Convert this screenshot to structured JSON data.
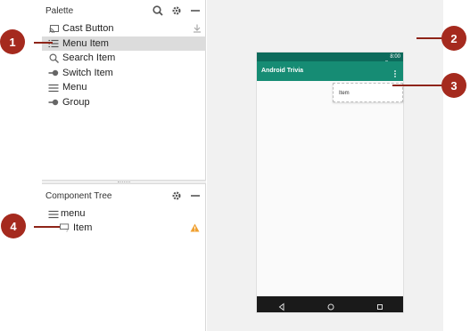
{
  "palette": {
    "title": "Palette",
    "items": [
      {
        "label": "Cast Button",
        "icon": "cast-icon"
      },
      {
        "label": "Menu Item",
        "icon": "menu-item-icon"
      },
      {
        "label": "Search Item",
        "icon": "search-icon"
      },
      {
        "label": "Switch Item",
        "icon": "switch-icon"
      },
      {
        "label": "Menu",
        "icon": "menu-icon"
      },
      {
        "label": "Group",
        "icon": "group-icon"
      }
    ]
  },
  "component_tree": {
    "title": "Component Tree",
    "root": {
      "label": "menu",
      "icon": "menu-icon"
    },
    "child": {
      "label": "Item",
      "icon": "menu-item-icon",
      "status": "warning-icon"
    }
  },
  "phone": {
    "status_time": "8:00",
    "app_title": "Android Trivia",
    "popup_item": "Item"
  },
  "callouts": [
    "1",
    "2",
    "3",
    "4"
  ],
  "colors": {
    "callout": "#a52a1e",
    "app_bar": "#168c74",
    "status_bar": "#0d6b5c",
    "selected_row": "#dcdcdc",
    "warning": "#f0a030"
  }
}
